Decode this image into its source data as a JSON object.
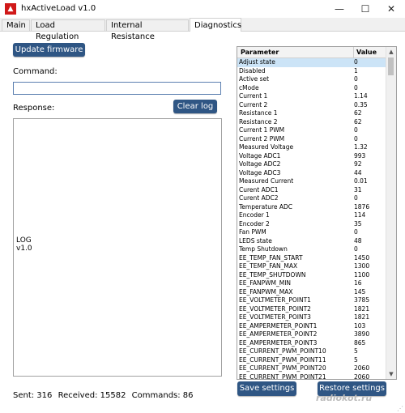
{
  "window": {
    "title": "hxActiveLoad v1.0",
    "minimize": "—",
    "maximize": "☐",
    "close": "✕"
  },
  "tabs": [
    "Main",
    "Load Regulation",
    "Internal Resistance",
    "Diagnostics"
  ],
  "active_tab": "Diagnostics",
  "buttons": {
    "update_firmware": "Update firmware",
    "clear_log": "Clear log",
    "save_settings": "Save settings",
    "restore_settings": "Restore settings"
  },
  "labels": {
    "command": "Command:",
    "response": "Response:"
  },
  "command_value": "",
  "log_text": "LOG\nv1.0",
  "status": {
    "sent": "Sent: 316",
    "received": "Received: 15582",
    "commands": "Commands: 86"
  },
  "table": {
    "headers": [
      "Parameter",
      "Value"
    ],
    "rows": [
      [
        "Adjust state",
        "0"
      ],
      [
        "Disabled",
        "1"
      ],
      [
        "Active set",
        "0"
      ],
      [
        "cMode",
        "0"
      ],
      [
        "Current 1",
        "1.14"
      ],
      [
        "Current 2",
        "0.35"
      ],
      [
        "Resistance 1",
        "62"
      ],
      [
        "Resistance 2",
        "62"
      ],
      [
        "Current 1 PWM",
        "0"
      ],
      [
        "Current 2 PWM",
        "0"
      ],
      [
        "Measured Voltage",
        "1.32"
      ],
      [
        "Voltage ADC1",
        "993"
      ],
      [
        "Voltage ADC2",
        "92"
      ],
      [
        "Voltage ADC3",
        "44"
      ],
      [
        "Measured Current",
        "0.01"
      ],
      [
        "Curent ADC1",
        "31"
      ],
      [
        "Curent ADC2",
        "0"
      ],
      [
        "Temperature ADC",
        "1876"
      ],
      [
        "Encoder 1",
        "114"
      ],
      [
        "Encoder 2",
        "35"
      ],
      [
        "Fan PWM",
        "0"
      ],
      [
        "LEDS state",
        "48"
      ],
      [
        "Temp Shutdown",
        "0"
      ],
      [
        "EE_TEMP_FAN_START",
        "1450"
      ],
      [
        "EE_TEMP_FAN_MAX",
        "1300"
      ],
      [
        "EE_TEMP_SHUTDOWN",
        "1100"
      ],
      [
        "EE_FANPWM_MIN",
        "16"
      ],
      [
        "EE_FANPWM_MAX",
        "145"
      ],
      [
        "EE_VOLTMETER_POINT1",
        "3785"
      ],
      [
        "EE_VOLTMETER_POINT2",
        "1821"
      ],
      [
        "EE_VOLTMETER_POINT3",
        "1821"
      ],
      [
        "EE_AMPERMETER_POINT1",
        "103"
      ],
      [
        "EE_AMPERMETER_POINT2",
        "3890"
      ],
      [
        "EE_AMPERMETER_POINT3",
        "865"
      ],
      [
        "EE_CURRENT_PWM_POINT10",
        "5"
      ],
      [
        "EE_CURRENT_PWM_POINT11",
        "5"
      ],
      [
        "EE_CURRENT_PWM_POINT20",
        "2060"
      ],
      [
        "EE_CURRENT_PWM_POINT21",
        "2060"
      ]
    ],
    "selected_index": 0
  },
  "watermark": "radiokot.ru",
  "colors": {
    "button_bg": "#2f5684",
    "selected_row": "#cce4f7"
  }
}
